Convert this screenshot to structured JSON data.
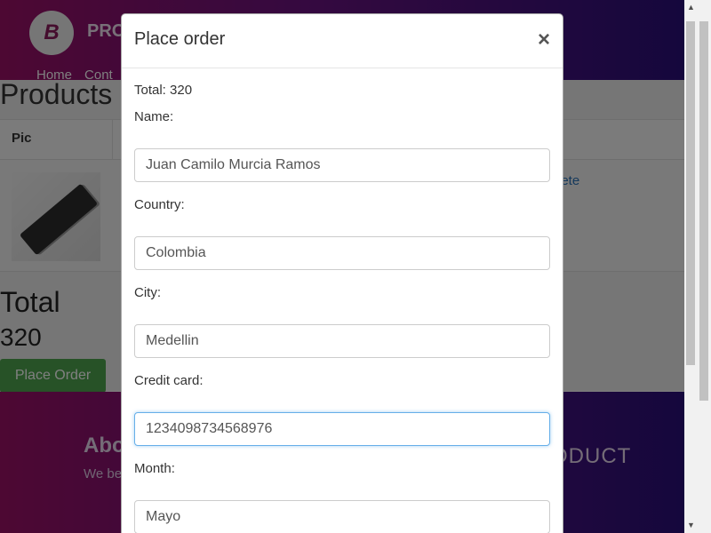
{
  "page": {
    "brand": "PRO",
    "nav": [
      "Home",
      "Cont"
    ],
    "products_title": "Products",
    "table": {
      "col_pic": "Pic",
      "delete": "lete"
    },
    "total_title": "Total",
    "total_value": "320",
    "place_order_button": "Place Order",
    "footer": {
      "about_title": "Abo",
      "about_text": "We be to be w of the cycle",
      "product_word": "ODUCT"
    }
  },
  "modal": {
    "title": "Place order",
    "close_symbol": "×",
    "total_line": "Total: 320",
    "fields": [
      {
        "label": "Name:",
        "value": "Juan Camilo Murcia Ramos"
      },
      {
        "label": "Country:",
        "value": "Colombia"
      },
      {
        "label": "City:",
        "value": "Medellin"
      },
      {
        "label": "Credit card:",
        "value": "1234098734568976"
      },
      {
        "label": "Month:",
        "value": "Mayo"
      }
    ]
  },
  "colors": {
    "accent_green": "#4ea54e",
    "brand_magenta": "#9b1066",
    "brand_indigo": "#2a0f7a",
    "focus_blue": "#66afe9",
    "link_blue": "#2a73b8"
  },
  "icons": [
    "close-icon",
    "logo-icon",
    "scroll-up-arrow-icon",
    "scroll-down-arrow-icon"
  ]
}
